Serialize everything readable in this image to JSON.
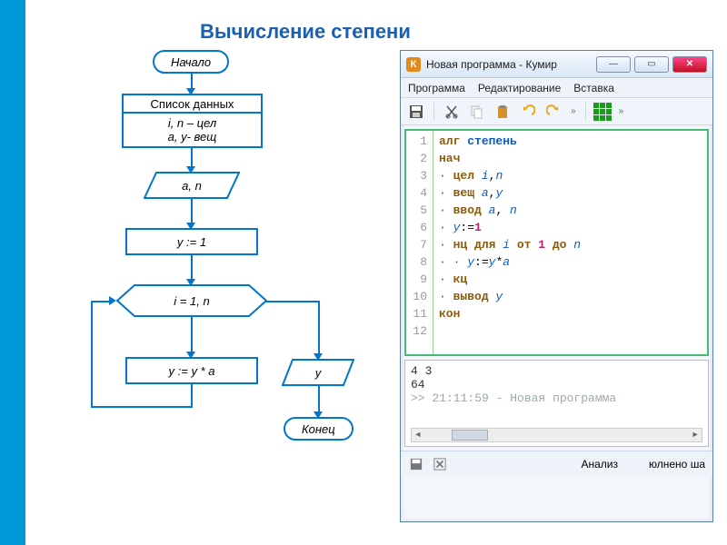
{
  "title": "Вычисление степени",
  "flowchart": {
    "start": "Начало",
    "data_header": "Список данных",
    "data_line1": "i, n – цел",
    "data_line2": "a, y- вещ",
    "input": "a, n",
    "init": "y := 1",
    "loop": "i = 1, n",
    "body": "y := y * a",
    "output": "y",
    "end": "Конец"
  },
  "kumir": {
    "window_title": "Новая программа - Кумир",
    "app_icon_letter": "К",
    "menu": [
      "Программа",
      "Редактирование",
      "Вставка"
    ],
    "toolbar_overflow": "»",
    "code_lines": [
      {
        "n": 1,
        "parts": [
          {
            "t": "алг ",
            "c": "kw"
          },
          {
            "t": "степень",
            "c": "kw2"
          }
        ]
      },
      {
        "n": 2,
        "parts": [
          {
            "t": "нач",
            "c": "kw"
          }
        ]
      },
      {
        "n": 3,
        "parts": [
          {
            "t": "· ",
            "c": "dot"
          },
          {
            "t": "цел ",
            "c": "kw"
          },
          {
            "t": "i",
            "c": "id"
          },
          {
            "t": ",",
            "c": ""
          },
          {
            "t": "n",
            "c": "id"
          }
        ]
      },
      {
        "n": 4,
        "parts": [
          {
            "t": "· ",
            "c": "dot"
          },
          {
            "t": "вещ ",
            "c": "kw"
          },
          {
            "t": "a",
            "c": "id"
          },
          {
            "t": ",",
            "c": ""
          },
          {
            "t": "y",
            "c": "id"
          }
        ]
      },
      {
        "n": 5,
        "parts": [
          {
            "t": "· ",
            "c": "dot"
          },
          {
            "t": "ввод ",
            "c": "kw"
          },
          {
            "t": "a",
            "c": "id"
          },
          {
            "t": ", ",
            "c": ""
          },
          {
            "t": "n",
            "c": "id"
          }
        ]
      },
      {
        "n": 6,
        "parts": [
          {
            "t": "· ",
            "c": "dot"
          },
          {
            "t": "y",
            "c": "id"
          },
          {
            "t": ":=",
            "c": ""
          },
          {
            "t": "1",
            "c": "num"
          }
        ]
      },
      {
        "n": 7,
        "parts": [
          {
            "t": "· ",
            "c": "dot"
          },
          {
            "t": "нц для ",
            "c": "kw"
          },
          {
            "t": "i",
            "c": "id"
          },
          {
            "t": " от ",
            "c": "kw"
          },
          {
            "t": "1",
            "c": "num"
          },
          {
            "t": " до ",
            "c": "kw"
          },
          {
            "t": "n",
            "c": "id"
          }
        ]
      },
      {
        "n": 8,
        "parts": [
          {
            "t": "· · ",
            "c": "dot"
          },
          {
            "t": "y",
            "c": "id"
          },
          {
            "t": ":=",
            "c": ""
          },
          {
            "t": "y",
            "c": "id"
          },
          {
            "t": "*",
            "c": ""
          },
          {
            "t": "a",
            "c": "id"
          }
        ]
      },
      {
        "n": 9,
        "parts": [
          {
            "t": "· ",
            "c": "dot"
          },
          {
            "t": "кц",
            "c": "kw"
          }
        ]
      },
      {
        "n": 10,
        "parts": [
          {
            "t": "· ",
            "c": "dot"
          },
          {
            "t": "вывод ",
            "c": "kw"
          },
          {
            "t": "y",
            "c": "id"
          }
        ]
      },
      {
        "n": 11,
        "parts": [
          {
            "t": "кон",
            "c": "kw"
          }
        ]
      },
      {
        "n": 12,
        "parts": []
      }
    ],
    "console": {
      "input": "4 3",
      "output": "64",
      "prompt": ">> 21:11:59 - Новая программа"
    },
    "status": {
      "analysis": "Анализ",
      "done": "юлнено ша"
    }
  }
}
